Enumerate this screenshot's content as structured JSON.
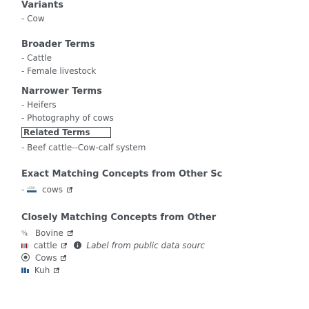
{
  "variants": {
    "heading": "Variants",
    "items": [
      "- Cow"
    ]
  },
  "broader": {
    "heading": "Broader Terms",
    "items": [
      "- Cattle",
      "- Female livestock"
    ]
  },
  "narrower": {
    "heading": "Narrower Terms",
    "items": [
      "- Heifers",
      "- Photography of cows"
    ]
  },
  "related": {
    "heading": "Related Terms",
    "items": [
      "- Beef cattle--Cow-calf system"
    ]
  },
  "exact": {
    "heading": "Exact Matching Concepts from Other Sc",
    "prefix": "- ",
    "items": [
      {
        "label": "cows",
        "icon": "lcsh-icon"
      }
    ]
  },
  "closely": {
    "heading": "Closely Matching Concepts from Other",
    "items": [
      {
        "label": "Bovine",
        "icon": "fast-icon"
      },
      {
        "label": "cattle",
        "icon": "wikidata-icon",
        "note": "Label from public data sourc"
      },
      {
        "label": "Cows",
        "icon": "lc-icon"
      },
      {
        "label": "Kuh",
        "icon": "gnd-icon"
      }
    ]
  }
}
